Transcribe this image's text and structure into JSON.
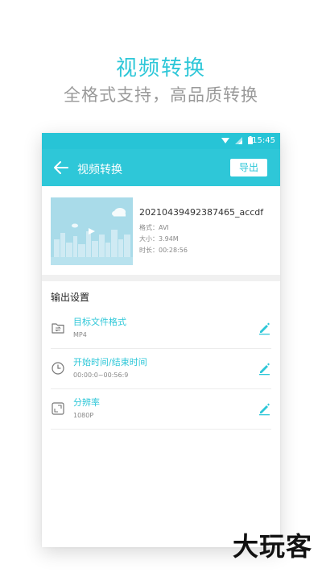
{
  "promo": {
    "title": "视频转换",
    "subtitle": "全格式支持，高品质转换"
  },
  "status_bar": {
    "time": "15:45",
    "icons": [
      "wifi-icon",
      "signal-icon",
      "battery-icon"
    ]
  },
  "app_bar": {
    "title": "视频转换",
    "export_label": "导出",
    "back_icon": "arrow-left-icon"
  },
  "file": {
    "name": "20210439492387465_accdf",
    "format": "格式：AVI",
    "size": "大小：3.94M",
    "duration": "时长：00:28:56"
  },
  "output_settings": {
    "title": "输出设置",
    "items": [
      {
        "label": "目标文件格式",
        "value": "MP4",
        "icon": "file-convert-icon"
      },
      {
        "label": "开始时间/结束时间",
        "value": "00:00:0~00:56:9",
        "icon": "clock-icon"
      },
      {
        "label": "分辨率",
        "value": "1080P",
        "icon": "resolution-icon"
      }
    ],
    "edit_icon": "pencil-icon"
  },
  "watermark": "大玩客",
  "colors": {
    "accent": "#2ec7d8",
    "status_bar": "#27c4d6",
    "thumbnail_bg": "#a9dbe9"
  }
}
